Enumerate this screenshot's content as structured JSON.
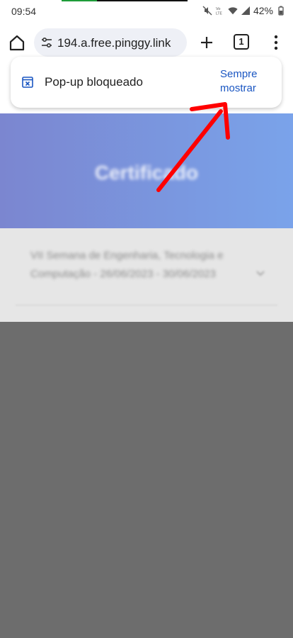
{
  "status_bar": {
    "time": "09:54",
    "battery": "42%",
    "icons": [
      "mute-icon",
      "volte-icon",
      "wifi-icon",
      "signal-icon",
      "battery-icon"
    ]
  },
  "toolbar": {
    "url": "194.a.free.pinggy.link",
    "tab_count": "1",
    "icons": [
      "home-icon",
      "tune-icon",
      "plus-icon",
      "tabs-icon",
      "more-vert-icon"
    ]
  },
  "popup": {
    "message": "Pop-up bloqueado",
    "action_line1": "Sempre",
    "action_line2": "mostrar",
    "accent": "#1a56c2"
  },
  "page": {
    "hero_title": "Certificado",
    "event_name": "VII Semana de Engenharia, Tecnologia e Computação - 26/06/2023 - 30/06/2023",
    "hero_colors": [
      "#7b86d0",
      "#7aa3ea"
    ],
    "overlay_color": "#6d6d6d"
  },
  "annotation": {
    "color": "#ff0000",
    "target": "popup.action"
  }
}
